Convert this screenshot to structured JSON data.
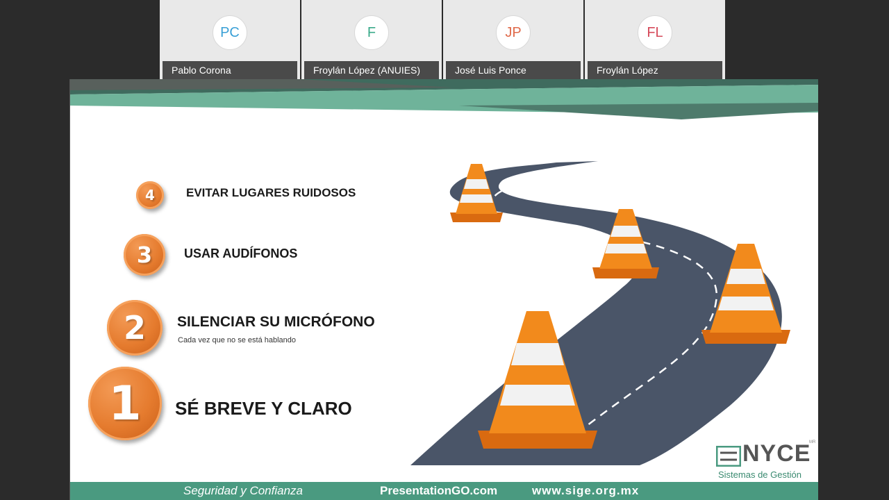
{
  "participants": [
    {
      "initials": "PC",
      "name": "Pablo Corona",
      "color": "#3aa0d6"
    },
    {
      "initials": "F",
      "name": "Froylán López (ANUIES)",
      "color": "#3aaa8a"
    },
    {
      "initials": "JP",
      "name": "José Luis Ponce",
      "color": "#e06a4a"
    },
    {
      "initials": "FL",
      "name": "Froylán López",
      "color": "#d64a5a"
    }
  ],
  "slide": {
    "steps": [
      {
        "number": "4",
        "label": "EVITAR LUGARES RUIDOSOS"
      },
      {
        "number": "3",
        "label": "USAR AUDÍFONOS"
      },
      {
        "number": "2",
        "label": "SILENCIAR SU MICRÓFONO",
        "sub": "Cada vez que no se está hablando"
      },
      {
        "number": "1",
        "label": "SÉ BREVE Y CLARO"
      }
    ],
    "logo": {
      "name": "NYCE",
      "sub": "Sistemas de Gestión",
      "mark": "MR"
    },
    "footer": {
      "tagline": "Seguridad y Confianza",
      "source": "PresentationGO.com",
      "url": "www.sige.org.mx"
    },
    "colors": {
      "accent": "#4a9a80",
      "orange": "#e57b2e",
      "road": "#4a5568"
    }
  }
}
